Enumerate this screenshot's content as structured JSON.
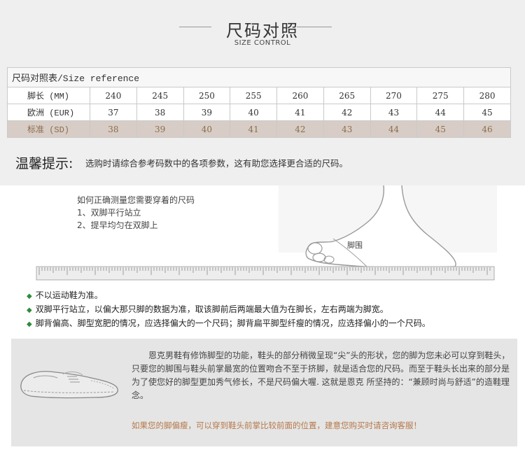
{
  "header": {
    "title": "尺码对照",
    "subtitle": "SIZE CONTROL"
  },
  "size_table": {
    "caption": "尺码对照表/Size reference",
    "rows": [
      {
        "label": "脚长 (MM)",
        "values": [
          "240",
          "245",
          "250",
          "255",
          "260",
          "265",
          "270",
          "275",
          "280"
        ]
      },
      {
        "label": "欧洲 (EUR)",
        "values": [
          "37",
          "38",
          "39",
          "40",
          "41",
          "42",
          "43",
          "44",
          "45"
        ]
      },
      {
        "label": "标准 (SD)",
        "values": [
          "38",
          "39",
          "40",
          "41",
          "42",
          "43",
          "44",
          "45",
          "46"
        ]
      }
    ]
  },
  "tip": {
    "label": "温馨提示:",
    "text": "选购时请综合参考码数中的各项参数，这有助您选择更合适的尺码。"
  },
  "measure": {
    "lines": [
      "如何正确测量您需要穿着的尺码",
      "1、双脚平行站立",
      "2、提早均匀在双脚上"
    ],
    "foot_label": "脚围"
  },
  "bullets": [
    "不以运动鞋为准。",
    "双脚平行站立，以偏大那只脚的数据为准，取该脚前后两端最大值为在脚长，左右两端为脚宽。",
    "脚背偏高、脚型宽肥的情况，应选择偏大的一个尺码；脚背扁平脚型纤瘦的情况，应选择偏小的一个尺码。"
  ],
  "panel": {
    "text": "恩克男鞋有修饰脚型的功能，鞋头的部分稍微呈现“尖”头的形状，您的脚为您未必可以穿到鞋头，只要您的脚围与鞋头前掌最宽的位置吻合不至于挤脚，就是适合您的尺码。而至于鞋头长出来的部分是为了使您好的脚型更加秀气修长，不是尺码偏大喔. 这就是恩克 所坚持的：“兼顾时尚与舒适”的造鞋理念。",
    "note": "如果您的脚偏瘦，可以穿到鞋头前掌比较前面的位置，建意您购买时请咨询客服！"
  },
  "colors": {
    "sd_row_bg": "#d7cdc6",
    "sd_row_text": "#8c6c4c",
    "bullet": "#2e8a3a",
    "note": "#b5784a",
    "panel_bg": "#e5e5e5"
  },
  "icons": {
    "bullet": "green-diamond-icon",
    "foot": "foot-illustration",
    "ruler": "ruler-graphic",
    "shoe": "shoe-illustration"
  }
}
